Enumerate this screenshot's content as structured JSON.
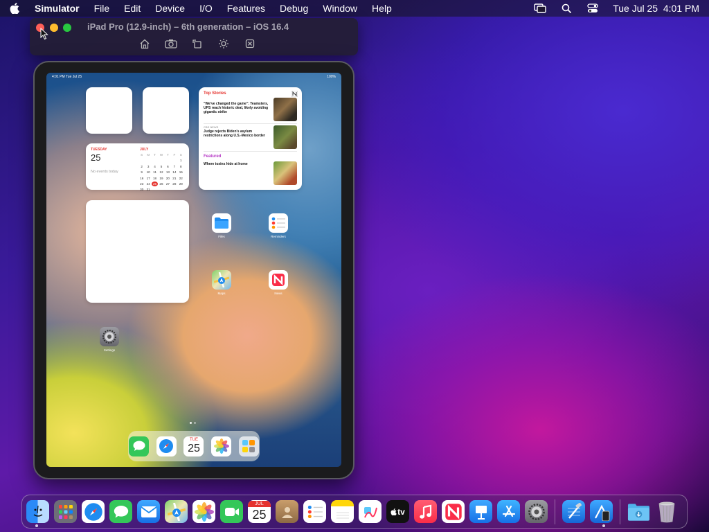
{
  "menubar": {
    "app_name": "Simulator",
    "items": [
      "File",
      "Edit",
      "Device",
      "I/O",
      "Features",
      "Debug",
      "Window",
      "Help"
    ],
    "clock": "Tue Jul 25  4:01 PM"
  },
  "simulator": {
    "title": "iPad Pro (12.9-inch) – 6th generation – iOS 16.4",
    "tools": [
      "home-icon",
      "screenshot-icon",
      "rotate-icon",
      "appearance-icon",
      "close-window-icon"
    ]
  },
  "ipad": {
    "status": {
      "time": "4:01 PM",
      "date": "Tue Jul 25",
      "battery": "100%"
    },
    "calendar_widget": {
      "dow": "TUESDAY",
      "date": "25",
      "no_events": "No events today",
      "month": "JULY",
      "weekdays": [
        "S",
        "M",
        "T",
        "W",
        "T",
        "F",
        "S"
      ],
      "days": [
        "",
        "",
        "",
        "",
        "",
        "",
        "1",
        "2",
        "3",
        "4",
        "5",
        "6",
        "7",
        "8",
        "9",
        "10",
        "11",
        "12",
        "13",
        "14",
        "15",
        "16",
        "17",
        "18",
        "19",
        "20",
        "21",
        "22",
        "23",
        "24",
        "25",
        "26",
        "27",
        "28",
        "29",
        "30",
        "31"
      ],
      "today": "25"
    },
    "news_widget": {
      "title": "Top Stories",
      "stories": [
        {
          "source": "",
          "headline": "\"We've changed the game\": Teamsters, UPS reach historic deal, likely avoiding gigantic strike"
        },
        {
          "source": "CBS NEWS",
          "headline": "Judge rejects Biden's asylum restrictions along U.S.-Mexico border"
        }
      ],
      "featured_title": "Featured",
      "featured_source": "",
      "featured_headline": "Where toxins hide at home"
    },
    "apps": [
      {
        "name": "Files",
        "icon": "files-icon"
      },
      {
        "name": "Reminders",
        "icon": "reminders-icon"
      },
      {
        "name": "Maps",
        "icon": "maps-icon"
      },
      {
        "name": "News",
        "icon": "news-icon"
      },
      {
        "name": "Settings",
        "icon": "settings-icon"
      }
    ],
    "dock": {
      "calendar_month": "TUE",
      "calendar_day": "25",
      "apps": [
        "messages-icon",
        "safari-icon",
        "calendar-icon",
        "photos-icon",
        "app-library-icon"
      ]
    }
  },
  "dock": {
    "calendar_month": "JUL",
    "calendar_day": "25",
    "tv_label": "tv",
    "apps": [
      "finder-icon",
      "launchpad-icon",
      "safari-icon",
      "messages-icon",
      "mail-icon",
      "maps-icon",
      "photos-icon",
      "facetime-icon",
      "calendar-icon",
      "contacts-icon",
      "reminders-icon",
      "notes-icon",
      "freeform-icon",
      "tv-icon",
      "music-icon",
      "news-icon",
      "keynote-icon",
      "app-store-icon",
      "system-settings-icon",
      "xcode-icon",
      "simulator-icon",
      "downloads-icon",
      "trash-icon"
    ]
  },
  "colors": {
    "accent_red": "#e5322d",
    "close": "#ff5f57",
    "minimize": "#febc2e",
    "maximize": "#28c840"
  }
}
